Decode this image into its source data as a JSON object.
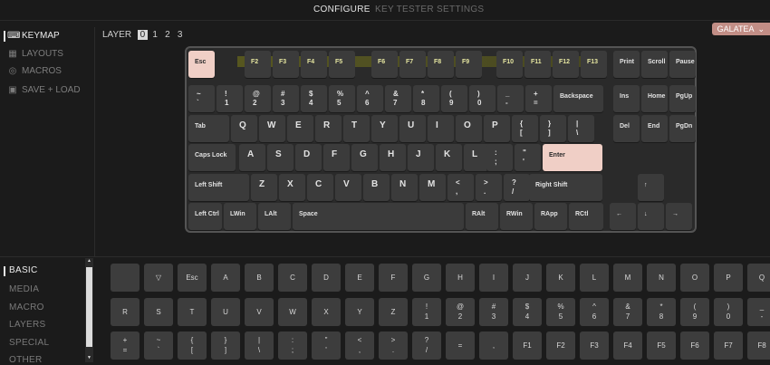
{
  "tabs": [
    "CONFIGURE",
    "KEY TESTER",
    "SETTINGS"
  ],
  "device": {
    "name": "GALATEA",
    "chevron": "chevron-down-icon"
  },
  "sidebar": {
    "items": [
      {
        "label": "KEYMAP",
        "icon": "keyboard-icon"
      },
      {
        "label": "LAYOUTS",
        "icon": "grid-icon"
      },
      {
        "label": "MACROS",
        "icon": "circle-target-icon"
      },
      {
        "label": "SAVE + LOAD",
        "icon": "floppy-disk-icon"
      }
    ]
  },
  "layer": {
    "label": "LAYER",
    "numbers": [
      "0",
      "1",
      "2",
      "3"
    ],
    "selected": "0"
  },
  "keyboard": {
    "row_fn": [
      "Esc",
      "F2",
      "F3",
      "F4",
      "F5",
      "F6",
      "F7",
      "F8",
      "F9",
      "F10",
      "F11",
      "F12",
      "F13",
      "Print",
      "Scroll",
      "Pause"
    ],
    "row_num": [
      [
        "~",
        "`"
      ],
      [
        "!",
        "1"
      ],
      [
        "@",
        "2"
      ],
      [
        "#",
        "3"
      ],
      [
        "$",
        "4"
      ],
      [
        "%",
        "5"
      ],
      [
        "^",
        "6"
      ],
      [
        "&",
        "7"
      ],
      [
        "*",
        "8"
      ],
      [
        "(",
        "9"
      ],
      [
        ")",
        "0"
      ],
      [
        "_",
        "-"
      ],
      [
        "+",
        "="
      ]
    ],
    "backspace": "Backspace",
    "nav1": [
      "Ins",
      "Home",
      "PgUp"
    ],
    "tab": "Tab",
    "row_q": [
      "Q",
      "W",
      "E",
      "R",
      "T",
      "Y",
      "U",
      "I",
      "O",
      "P"
    ],
    "row_q_sym": [
      [
        "{",
        "["
      ],
      [
        "}",
        "]"
      ],
      [
        "|",
        "\\"
      ]
    ],
    "nav2": [
      "Del",
      "End",
      "PgDn"
    ],
    "caps": "Caps Lock",
    "row_a": [
      "A",
      "S",
      "D",
      "F",
      "G",
      "H",
      "J",
      "K",
      "L"
    ],
    "row_a_sym": [
      [
        ":",
        ";"
      ],
      [
        "\"",
        "'"
      ]
    ],
    "enter": "Enter",
    "lshift": "Left Shift",
    "row_z": [
      "Z",
      "X",
      "C",
      "V",
      "B",
      "N",
      "M"
    ],
    "row_z_sym": [
      [
        "<",
        ","
      ],
      [
        ">",
        "."
      ],
      [
        "?",
        "/"
      ]
    ],
    "rshift": "Right Shift",
    "arrow_up": "↑",
    "bottom": [
      "Left Ctrl",
      "LWin",
      "LAlt",
      "Space",
      "RAlt",
      "RWin",
      "RApp",
      "RCtl"
    ],
    "arrows": [
      "←",
      "↓",
      "→"
    ]
  },
  "categories": [
    "BASIC",
    "MEDIA",
    "MACRO",
    "LAYERS",
    "SPECIAL",
    "OTHER"
  ],
  "picker": {
    "row1": [
      "",
      "▽",
      "Esc",
      "A",
      "B",
      "C",
      "D",
      "E",
      "F",
      "G",
      "H",
      "I",
      "J",
      "K",
      "L",
      "M",
      "N",
      "O",
      "P",
      "Q"
    ],
    "row2": [
      [
        "R"
      ],
      [
        "S"
      ],
      [
        "T"
      ],
      [
        "U"
      ],
      [
        "V"
      ],
      [
        "W"
      ],
      [
        "X"
      ],
      [
        "Y"
      ],
      [
        "Z"
      ],
      [
        "!",
        "1"
      ],
      [
        "@",
        "2"
      ],
      [
        "#",
        "3"
      ],
      [
        "$",
        "4"
      ],
      [
        "%",
        "5"
      ],
      [
        "^",
        "6"
      ],
      [
        "&",
        "7"
      ],
      [
        "*",
        "8"
      ],
      [
        "(",
        "9"
      ],
      [
        ")",
        "0"
      ],
      [
        "_",
        "-"
      ]
    ],
    "row3": [
      [
        "+",
        "="
      ],
      [
        "~",
        "`"
      ],
      [
        "{",
        "["
      ],
      [
        "}",
        "]"
      ],
      [
        "|",
        "\\"
      ],
      [
        ":",
        ";"
      ],
      [
        "\"",
        "'"
      ],
      [
        "<",
        ","
      ],
      [
        ">",
        "."
      ],
      [
        "?",
        "/"
      ],
      [
        "="
      ],
      [
        ","
      ],
      [
        "F1"
      ],
      [
        "F2"
      ],
      [
        "F3"
      ],
      [
        "F4"
      ],
      [
        "F5"
      ],
      [
        "F6"
      ],
      [
        "F7"
      ],
      [
        "F8"
      ]
    ]
  }
}
